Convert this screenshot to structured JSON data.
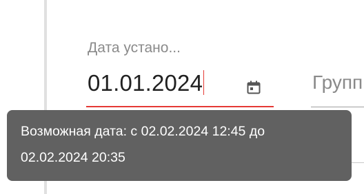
{
  "date_field": {
    "label": "Дата устано...",
    "value": "01.01.2024",
    "state": "error",
    "icon": "calendar-icon",
    "error_color": "#e53935"
  },
  "group_field": {
    "placeholder": "Групп"
  },
  "tooltip": {
    "line1": "Возможная дата: с 02.02.2024 12:45 до",
    "line2": "02.02.2024 20:35",
    "background": "#616161"
  }
}
